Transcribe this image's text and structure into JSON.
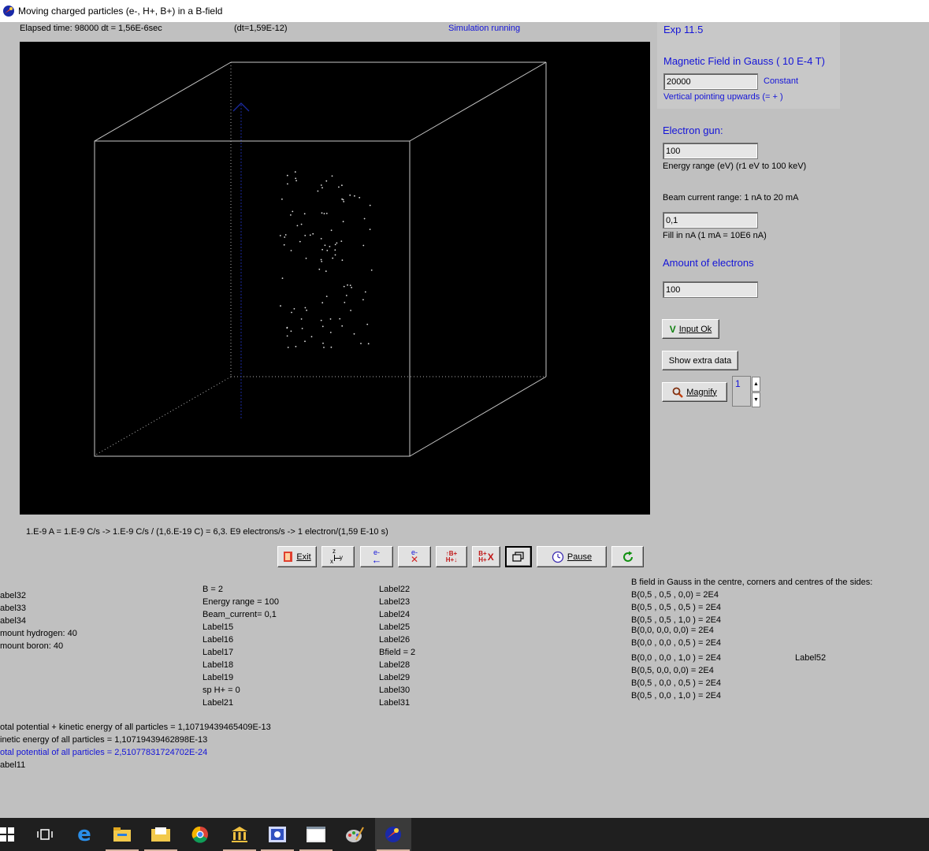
{
  "window": {
    "title": "Moving charged particles (e-, H+, B+) in a B-field"
  },
  "status": {
    "elapsed": "Elapsed time: 98000 dt   = 1,56E-6sec",
    "dt": "(dt=1,59E-12)",
    "running": "Simulation running"
  },
  "experiment": {
    "label": "Exp 11.5"
  },
  "bfield": {
    "heading": "Magnetic Field in Gauss ( 10 E-4 T)",
    "value": "20000",
    "mode": "Constant",
    "direction": "Vertical pointing upwards (=  + )"
  },
  "gun": {
    "heading": "Electron gun:",
    "energy_value": "100",
    "energy_label": "Energy range (eV)     (r1 eV to 100 keV)",
    "beam_range": "Beam current range: 1 nA to 20 mA",
    "current_value": "0,1",
    "current_label": "Fill in nA (1 mA = 10E6 nA)",
    "amount_heading": "Amount of electrons",
    "amount_value": "100"
  },
  "buttons": {
    "input_ok": "Input Ok",
    "input_ok_mark": "V",
    "extra": "Show extra data",
    "magnify": "Magnify",
    "exit": "Exit",
    "pause": "Pause"
  },
  "magnify_spin": {
    "value": "1"
  },
  "formula": "1.E-9 A = 1.E-9 C/s  ->  1.E-9 C/s / (1,6.E-19 C) = 6,3. E9   electrons/s  -> 1 electron/(1,59 E-10 s)",
  "toolbar_icons": {
    "axes": [
      "z",
      "y",
      "x"
    ],
    "e_left": [
      "e-",
      "←"
    ],
    "e_del": [
      "e-",
      "✕"
    ],
    "bh_swap": [
      "↑B+",
      "H+↓"
    ],
    "bh_del": [
      "B+",
      "H+",
      "X"
    ]
  },
  "col1": [
    "abel32",
    "abel33",
    "abel34",
    "mount hydrogen: 40",
    "mount boron: 40"
  ],
  "col2": [
    "B = 2",
    "Energy range = 100",
    "Beam_current= 0,1",
    "Label15",
    "Label16",
    "Label17",
    "Label18",
    "Label19",
    "sp H+ =  0",
    "Label21"
  ],
  "col3": [
    "Label22",
    "Label23",
    "Label24",
    "Label25",
    "Label26",
    "Bfield = 2",
    "Label28",
    "Label29",
    "Label30",
    "Label31"
  ],
  "bfield_table": {
    "heading": "B field in Gauss in the centre, corners and centres of the sides:",
    "r1": "B(0,5 , 0,5 , 0,0) = 2E4",
    "r2": "B(0,5 , 0,5 , 0,5 ) = 2E4",
    "r3": "B(0,5 , 0,5 , 1,0 ) = 2E4",
    "r4": "B(0,0, 0,0, 0,0) = 2E4",
    "r5": "B(0,0 , 0,0 , 0,5 ) = 2E4",
    "r6": "B(0,0 , 0,0 , 1,0 ) = 2E4",
    "r7": "B(0,5, 0,0, 0,0) = 2E4",
    "r8": "B(0,5 , 0,0 , 0,5 ) = 2E4",
    "r9": "B(0,5 , 0,0 , 1,0 ) = 2E4"
  },
  "label52": "Label52",
  "energy": {
    "total": "otal potential + kinetic energy of all particles = 1,10719439465409E-13",
    "kinetic": "inetic energy of all particles = 1,10719439462898E-13",
    "potential": "otal potential of all particles = 2,51077831724702E-24",
    "label11": "abel11"
  },
  "colors": {
    "accent_blue": "#1414d8",
    "canvas": "#000000",
    "face": "#c0c0c0"
  },
  "taskbar_icons": [
    "windows-start-icon",
    "task-view-icon",
    "edge-icon",
    "file-explorer-icon",
    "mail-folder-icon",
    "chrome-icon",
    "museum-icon",
    "media-icon",
    "window-icon",
    "paint-icon",
    "simulation-app-icon"
  ]
}
